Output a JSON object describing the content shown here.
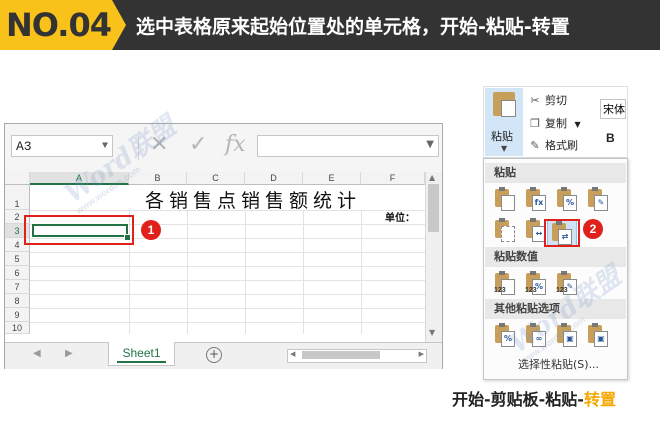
{
  "banner": {
    "step_badge": "NO.04",
    "title": "选中表格原来起始位置处的单元格，开始-粘贴-转置"
  },
  "colors": {
    "accent_yellow": "#f9c21a",
    "excel_green": "#217346",
    "marker_red": "#e0201b",
    "banner_bg": "#333333"
  },
  "excel": {
    "name_box": "A3",
    "formula_icons": [
      "close-icon",
      "check-icon",
      "fx-icon"
    ],
    "fx_label": "fx",
    "columns": [
      "A",
      "B",
      "C",
      "D",
      "E",
      "F"
    ],
    "rows": [
      "1",
      "2",
      "3",
      "4",
      "5",
      "6",
      "7",
      "8",
      "9",
      "10"
    ],
    "selected_cell": "A3",
    "sheet_title": "各销售点销售额统计",
    "unit_label": "单位：",
    "sheet_tab": "Sheet1",
    "add_sheet_symbol": "+"
  },
  "ribbon": {
    "paste_label": "粘贴",
    "cut_label": "剪切",
    "copy_label": "复制",
    "format_painter_label": "格式刷",
    "font_name": "宋体",
    "bold_label": "B"
  },
  "paste_menu": {
    "section_paste": "粘贴",
    "section_values": "粘贴数值",
    "section_other": "其他粘贴选项",
    "values_sub": [
      "123",
      "123",
      "123"
    ],
    "paste_special": "选择性粘贴(S)..."
  },
  "markers": {
    "step1": "1",
    "step2": "2"
  },
  "watermark": {
    "brand": "Word联盟",
    "url": "www.wordlm.com"
  },
  "caption": {
    "prefix": "开始-剪贴板-粘贴-",
    "highlight": "转置"
  }
}
